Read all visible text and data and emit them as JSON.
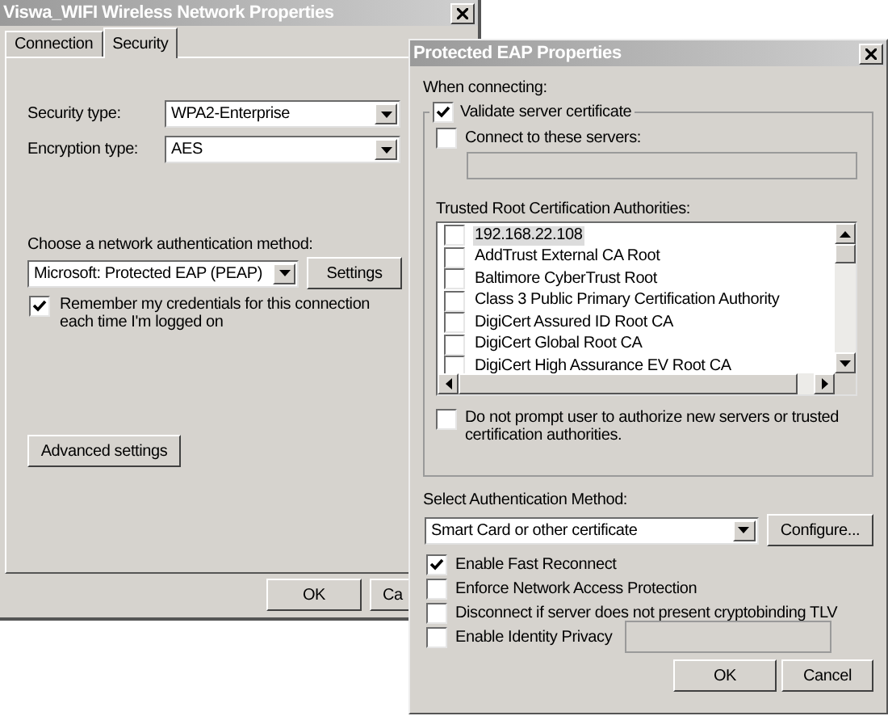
{
  "main_window": {
    "title": "Viswa_WIFI Wireless Network Properties",
    "tabs": [
      {
        "label": "Connection",
        "selected": false
      },
      {
        "label": "Security",
        "selected": true
      }
    ],
    "security_type": {
      "label": "Security type:",
      "value": "WPA2-Enterprise"
    },
    "encryption_type": {
      "label": "Encryption type:",
      "value": "AES"
    },
    "auth_method": {
      "label": "Choose a network authentication method:",
      "value": "Microsoft: Protected EAP (PEAP)",
      "button": "Settings"
    },
    "remember_credentials": {
      "label": "Remember my credentials for this connection each time I'm logged on",
      "checked": true
    },
    "advanced_button": "Advanced settings",
    "buttons": [
      "OK",
      "Ca"
    ]
  },
  "eap_window": {
    "title": "Protected EAP Properties",
    "when_connecting": "When connecting:",
    "validate_server": {
      "label": "Validate server certificate",
      "checked": true
    },
    "connect_servers": {
      "label": "Connect to these servers:",
      "checked": false
    },
    "trusted_label": "Trusted Root Certification Authorities:",
    "certificates": [
      {
        "label": "192.168.22.108",
        "checked": false,
        "selected": true
      },
      {
        "label": "AddTrust External CA Root",
        "checked": false,
        "selected": false
      },
      {
        "label": "Baltimore CyberTrust Root",
        "checked": false,
        "selected": false
      },
      {
        "label": "Class 3 Public Primary Certification Authority",
        "checked": false,
        "selected": false
      },
      {
        "label": "DigiCert Assured ID Root CA",
        "checked": false,
        "selected": false
      },
      {
        "label": "DigiCert Global Root CA",
        "checked": false,
        "selected": false
      },
      {
        "label": "DigiCert High Assurance EV Root CA",
        "checked": false,
        "selected": false
      }
    ],
    "no_prompt": {
      "label": "Do not prompt user to authorize new servers or trusted certification authorities.",
      "checked": false
    },
    "auth_method_label": "Select Authentication Method:",
    "auth_method": {
      "value": "Smart Card or other certificate",
      "button": "Configure..."
    },
    "options": [
      {
        "kind": "checkbox",
        "label": "Enable Fast Reconnect",
        "checked": true
      },
      {
        "kind": "checkbox",
        "label": "Enforce Network Access Protection",
        "checked": false
      },
      {
        "kind": "checkbox",
        "label": "Disconnect if server does not present cryptobinding TLV",
        "checked": false
      },
      {
        "kind": "checkbox_field",
        "label": "Enable Identity Privacy",
        "checked": false
      }
    ],
    "buttons": [
      "OK",
      "Cancel"
    ]
  }
}
